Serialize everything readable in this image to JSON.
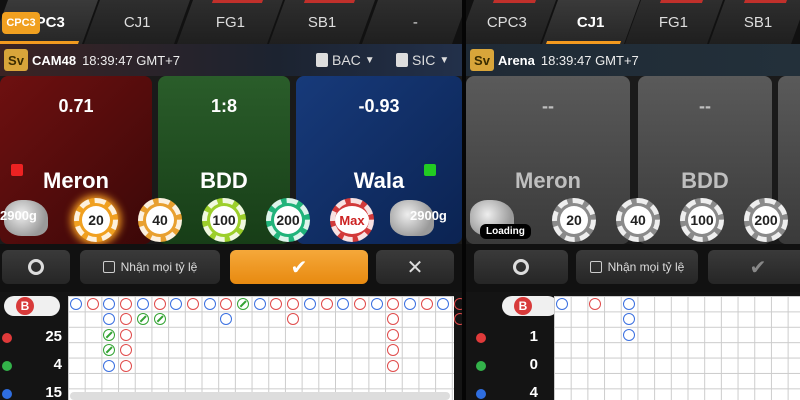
{
  "panel1": {
    "logo_text": "CPC3",
    "tabs": [
      "CPC3",
      "CJ1",
      "FG1",
      "SB1",
      "-"
    ],
    "room": "CAM48",
    "time": "18:39:47 GMT+7",
    "dd1": "BAC",
    "dd2": "SIC",
    "bets": [
      {
        "odds": "0.71",
        "label": "Meron"
      },
      {
        "odds": "1:8",
        "label": "BDD"
      },
      {
        "odds": "-0.93",
        "label": "Wala"
      }
    ],
    "balance_left": "2900g",
    "balance_right": "2900g",
    "chips": [
      "20",
      "40",
      "100",
      "200",
      "Max"
    ],
    "accept_odds": "Nhận mọi tỷ lệ",
    "confirm_icon": "✔",
    "close_icon": "✕",
    "stats": {
      "badge": "B",
      "red": "25",
      "green": "4",
      "blue": "15"
    }
  },
  "panel2": {
    "tabs": [
      "CPC3",
      "CJ1",
      "FG1",
      "SB1"
    ],
    "room": "Arena",
    "time": "18:39:47 GMT+7",
    "bets": [
      {
        "odds": "--",
        "label": "Meron"
      },
      {
        "odds": "--",
        "label": "BDD"
      }
    ],
    "loading": "Loading",
    "chips": [
      "20",
      "40",
      "100",
      "200"
    ],
    "accept_odds": "Nhận mọi tỷ lệ",
    "confirm_icon": "✔",
    "stats": {
      "badge": "B",
      "red": "1",
      "green": "0",
      "blue": "4"
    }
  },
  "colors": {
    "accent": "#f29a1f",
    "meron": "#6e1010",
    "bdd": "#2a5d2a",
    "wala": "#173a7a"
  },
  "icons": {
    "settings": "gear-icon",
    "checkbox": "checkbox-icon"
  }
}
